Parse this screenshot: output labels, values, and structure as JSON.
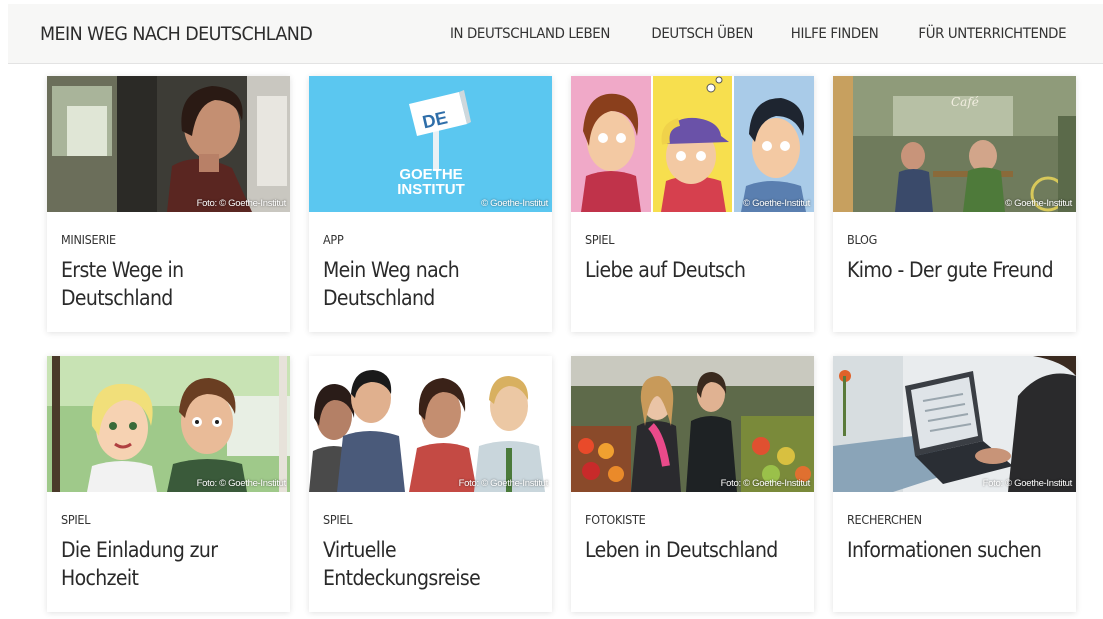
{
  "header": {
    "site_title": "MEIN WEG NACH DEUTSCHLAND",
    "nav": [
      {
        "label": "IN DEUTSCHLAND LEBEN"
      },
      {
        "label": "DEUTSCH ÜBEN"
      },
      {
        "label": "HILFE FINDEN"
      },
      {
        "label": "FÜR UNTERRICHTENDE"
      }
    ]
  },
  "cards": [
    {
      "category": "MINISERIE",
      "title": "Erste Wege in Deutschland",
      "credit": "Foto: © Goethe-Institut",
      "image": "woman-portrait-photo"
    },
    {
      "category": "APP",
      "title": "Mein Weg nach Deutschland",
      "credit": "© Goethe-Institut",
      "image": "goethe-app-logo",
      "logo_sign": "DE",
      "logo_line1": "GOETHE",
      "logo_line2": "INSTITUT"
    },
    {
      "category": "SPIEL",
      "title": "Liebe auf Deutsch",
      "credit": "© Goethe-Institut",
      "image": "comic-characters"
    },
    {
      "category": "BLOG",
      "title": "Kimo - Der gute Freund",
      "credit": "© Goethe-Institut",
      "image": "cafe-illustration",
      "sign_text": "Café"
    },
    {
      "category": "SPIEL",
      "title": "Die Einladung zur Hochzeit",
      "credit": "Foto: © Goethe-Institut",
      "image": "cartoon-couple"
    },
    {
      "category": "SPIEL",
      "title": "Virtuelle Entdeckungsreise",
      "credit": "Foto: © Goethe-Institut",
      "image": "illustrated-people"
    },
    {
      "category": "FOTOKISTE",
      "title": "Leben in Deutschland",
      "credit": "Foto: © Goethe-Institut",
      "image": "market-photo"
    },
    {
      "category": "RECHERCHEN",
      "title": "Informationen suchen",
      "credit": "Foto: © Goethe-Institut",
      "image": "laptop-photo"
    }
  ]
}
